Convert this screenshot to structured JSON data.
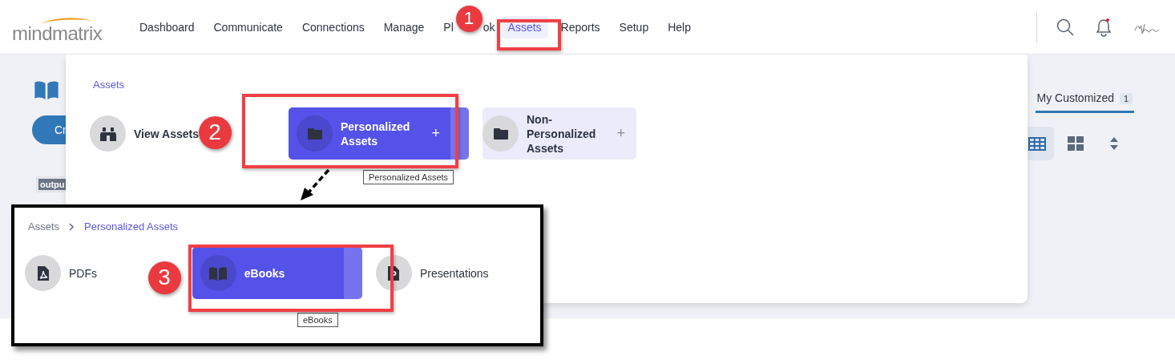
{
  "header": {
    "logo": "mindmatrix",
    "nav": [
      {
        "label": "Dashboard",
        "selected": false
      },
      {
        "label": "Communicate",
        "selected": false
      },
      {
        "label": "Connections",
        "selected": false
      },
      {
        "label": "Manage",
        "selected": false
      },
      {
        "label": "Pl",
        "tail": "ok",
        "selected": false
      },
      {
        "label": "Assets",
        "selected": true
      },
      {
        "label": "Reports",
        "selected": false
      },
      {
        "label": "Setup",
        "selected": false
      },
      {
        "label": "Help",
        "selected": false
      }
    ],
    "notification_dot": true
  },
  "page": {
    "create_button": "Cr",
    "tag": "outpu",
    "tabs": [
      {
        "label": "My Customized",
        "count": "1",
        "selected": true
      }
    ],
    "view_buttons": [
      {
        "kind": "table",
        "selected": true
      },
      {
        "kind": "grid",
        "selected": false
      },
      {
        "kind": "sort",
        "selected": false
      }
    ]
  },
  "menu": {
    "breadcrumb": [
      {
        "label": "Assets"
      }
    ],
    "items": [
      {
        "kind": "view",
        "label": "View Assets",
        "selected": false,
        "hovered": false
      },
      {
        "kind": "folder",
        "label": "Personalized Assets",
        "selected": true,
        "hovered": false,
        "add_icon": "+"
      },
      {
        "kind": "folder",
        "label": "Non-Personalized Assets",
        "selected": false,
        "hovered": true,
        "add_icon": "+"
      }
    ],
    "tooltip": "Personalized Assets"
  },
  "inset": {
    "breadcrumb": [
      {
        "label": "Assets"
      },
      {
        "label": "Personalized Assets"
      }
    ],
    "items": [
      {
        "kind": "pdf",
        "label": "PDFs",
        "selected": false
      },
      {
        "kind": "book",
        "label": "eBooks",
        "selected": true
      },
      {
        "kind": "presentation",
        "label": "Presentations",
        "selected": false
      }
    ],
    "tooltip": "eBooks"
  },
  "callouts": [
    {
      "number": "1"
    },
    {
      "number": "2"
    },
    {
      "number": "3"
    }
  ]
}
